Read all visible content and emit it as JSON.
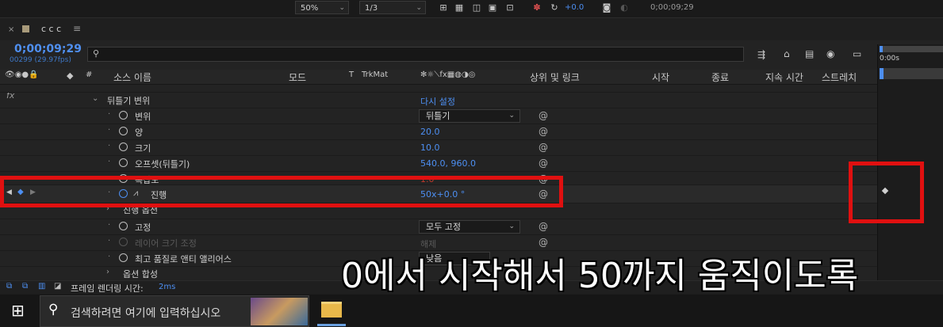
{
  "viewer": {
    "zoom": "50%",
    "resolution": "1/3",
    "exposure": "+0.0",
    "timecode": "0;00;09;29"
  },
  "panel": {
    "tab_title": "c c c",
    "current_time": "0;00;09;29",
    "frame_info": "00299 (29.97fps)",
    "search_placeholder": "",
    "time_ruler_label": "0:00s"
  },
  "columns": {
    "switches": "",
    "source_name": "소스 이름",
    "mode": "모드",
    "t": "T",
    "trkmat": "TrkMat",
    "parent_link": "상위 및 링크",
    "start": "시작",
    "end": "종료",
    "duration": "지속 시간",
    "stretch": "스트레치",
    "hash": "#"
  },
  "rows": [
    {
      "label": "뒤틀기 변위",
      "value": "다시 설정",
      "type": "group"
    },
    {
      "label": "변위",
      "value": "뒤틀기",
      "type": "dropdown"
    },
    {
      "label": "양",
      "value": "20.0",
      "type": "value"
    },
    {
      "label": "크기",
      "value": "10.0",
      "type": "value"
    },
    {
      "label": "오프셋(뒤틀기)",
      "value": "540.0, 960.0",
      "type": "value"
    },
    {
      "label": "복잡도",
      "value": "1.0",
      "type": "value"
    },
    {
      "label": "진행",
      "value": "50x+0.0 °",
      "type": "value-keyframed"
    },
    {
      "label": "진행 옵션",
      "value": "",
      "type": "subgroup"
    },
    {
      "label": "고정",
      "value": "모두 고정",
      "type": "dropdown"
    },
    {
      "label": "레이어 크기 조정",
      "value": "해제",
      "type": "disabled"
    },
    {
      "label": "최고 품질로 앤티 앨리어스",
      "value": "낮음",
      "type": "dropdown"
    },
    {
      "label": "옵션 합성",
      "value": "",
      "type": "subgroup"
    }
  ],
  "bottom": {
    "render_label": "프레임 렌더링 시간:",
    "render_value": "2ms"
  },
  "taskbar": {
    "search_placeholder": "검색하려면 여기에 입력하십시오"
  },
  "caption": "0에서 시작해서 50까지 움직이도록",
  "colors": {
    "accent_blue": "#4d8ff2",
    "highlight_red": "#e01010",
    "panel_bg": "#232323"
  }
}
